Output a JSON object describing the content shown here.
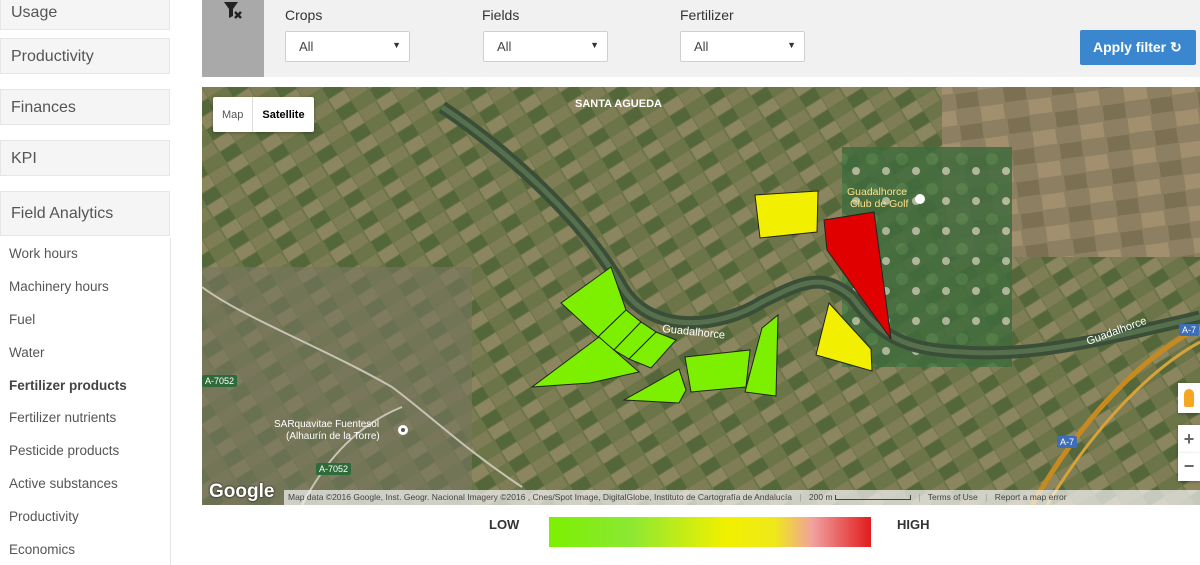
{
  "sidebar": {
    "sections": [
      "Usage",
      "Productivity",
      "Finances",
      "KPI",
      "Field Analytics"
    ],
    "subitems": [
      "Work hours",
      "Machinery hours",
      "Fuel",
      "Water",
      "Fertilizer products",
      "Fertilizer nutrients",
      "Pesticide products",
      "Active substances",
      "Productivity",
      "Economics"
    ],
    "active_subitem": "Fertilizer products"
  },
  "filters": {
    "crops": {
      "label": "Crops",
      "value": "All"
    },
    "fields": {
      "label": "Fields",
      "value": "All"
    },
    "fertilizer": {
      "label": "Fertilizer",
      "value": "All"
    },
    "apply_label": "Apply filter",
    "clear_icon": "filter-clear-icon"
  },
  "map": {
    "type_map": "Map",
    "type_satellite": "Satellite",
    "labels": {
      "santa_agueda": "SANTA AGUEDA",
      "river1": "Guadalhorce",
      "river2": "Guadalhorce",
      "club1": "Guadalhorce",
      "club2": "Club de Golf",
      "place1": "SARquavitae Fuentesol",
      "place2": "(Alhaurín de la Torre)",
      "road1": "A-7052",
      "road2": "A-7052",
      "road3": "A-7",
      "road4": "A-7"
    },
    "google": "Google",
    "attribution": "Map data ©2016 Google, Inst. Geogr. Nacional Imagery ©2016 , Cnes/Spot Image, DigitalGlobe, Instituto de Cartografía de Andalucía",
    "scale": "200 m",
    "terms": "Terms of Use",
    "report": "Report a map error"
  },
  "legend": {
    "low": "LOW",
    "high": "HIGH"
  },
  "colors": {
    "high": "#e10000",
    "mid": "#f2f000",
    "low": "#7cf000",
    "accent": "#3a87cf"
  }
}
